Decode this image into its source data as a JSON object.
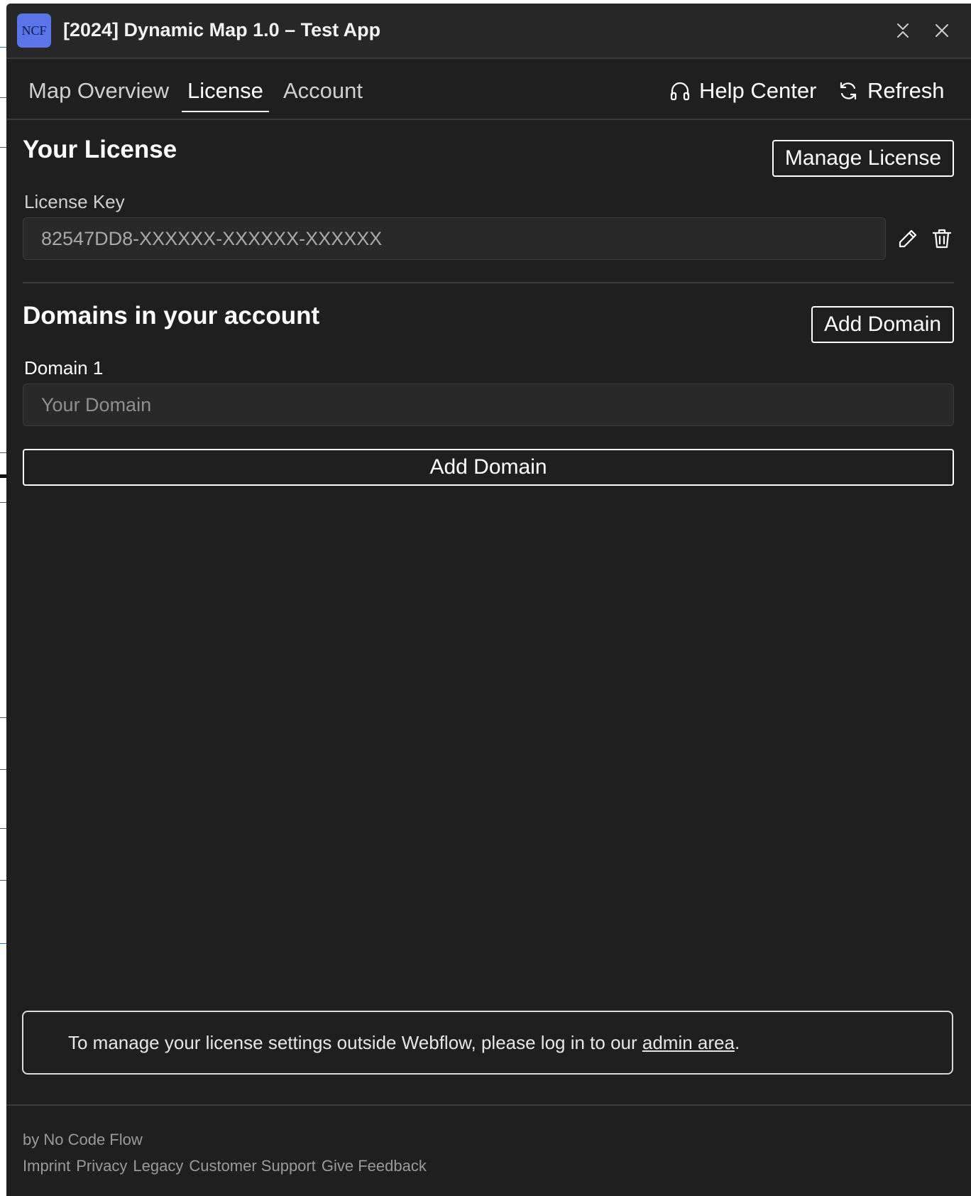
{
  "window": {
    "logo_text": "NCF",
    "title": "[2024] Dynamic Map 1.0 – Test App"
  },
  "nav": {
    "tabs": [
      {
        "label": "Map Overview",
        "active": false
      },
      {
        "label": "License",
        "active": true
      },
      {
        "label": "Account",
        "active": false
      }
    ],
    "help_label": "Help Center",
    "refresh_label": "Refresh"
  },
  "license": {
    "title": "Your License",
    "manage_button": "Manage License",
    "key_label": "License Key",
    "key_value": "82547DD8-XXXXXX-XXXXXX-XXXXXX"
  },
  "domains": {
    "title": "Domains in your account",
    "add_button_top": "Add Domain",
    "domain_label": "Domain 1",
    "domain_placeholder": "Your Domain",
    "add_button_full": "Add Domain"
  },
  "notice": {
    "text_before": "To manage your license settings outside Webflow, please log in to our ",
    "link_text": "admin area",
    "text_after": "."
  },
  "footer": {
    "by": "by No Code Flow",
    "links": [
      "Imprint",
      "Privacy",
      "Legacy",
      "Customer Support",
      "Give Feedback"
    ]
  },
  "colors": {
    "background": "#1f1f1f",
    "titlebar": "#272727",
    "logo": "#5b74e8",
    "field": "#292929"
  }
}
